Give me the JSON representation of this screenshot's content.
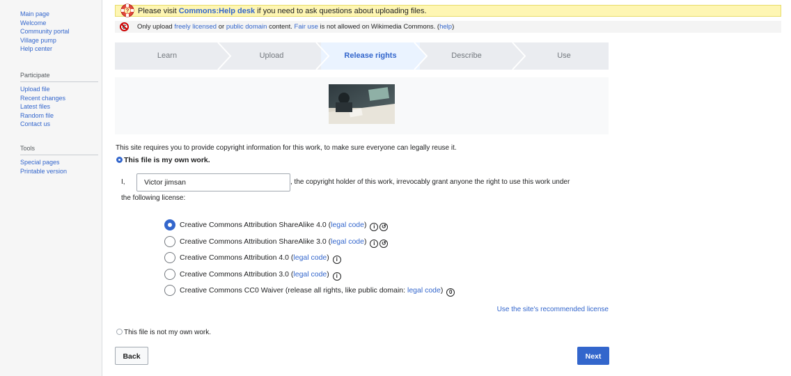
{
  "sidebar": {
    "navigation": [
      "Main page",
      "Welcome",
      "Community portal",
      "Village pump",
      "Help center"
    ],
    "participate_heading": "Participate",
    "participate": [
      "Upload file",
      "Recent changes",
      "Latest files",
      "Random file",
      "Contact us"
    ],
    "tools_heading": "Tools",
    "tools": [
      "Special pages",
      "Printable version"
    ]
  },
  "notice_help": {
    "prefix": "Please visit ",
    "link": "Commons:Help desk",
    "suffix": " if you need to ask questions about uploading files."
  },
  "notice_license": {
    "t1": "Only upload ",
    "l1": "freely licensed",
    "t2": " or ",
    "l2": "public domain",
    "t3": " content. ",
    "l3": "Fair use",
    "t4": " is not allowed on Wikimedia Commons. (",
    "l4": "help",
    "t5": ")"
  },
  "steps": [
    "Learn",
    "Upload",
    "Release rights",
    "Describe",
    "Use"
  ],
  "active_step": "Release rights",
  "intro": "This site requires you to provide copyright information for this work, to make sure everyone can legally reuse it.",
  "own_work_label": "This file is my own work.",
  "grant": {
    "prefix": "I,",
    "name_value": "Victor jimsan",
    "suffix": ", the copyright holder of this work, irrevocably grant anyone the right to use this work under",
    "line2": "the following license:"
  },
  "licenses": [
    {
      "text": "Creative Commons Attribution ShareAlike 4.0 (",
      "link": "legal code",
      "after": ")",
      "selected": true,
      "icons": [
        "attribution-icon",
        "sharealike-icon"
      ]
    },
    {
      "text": "Creative Commons Attribution ShareAlike 3.0 (",
      "link": "legal code",
      "after": ")",
      "selected": false,
      "icons": [
        "attribution-icon",
        "sharealike-icon"
      ]
    },
    {
      "text": "Creative Commons Attribution 4.0 (",
      "link": "legal code",
      "after": ")",
      "selected": false,
      "icons": [
        "attribution-icon"
      ]
    },
    {
      "text": "Creative Commons Attribution 3.0 (",
      "link": "legal code",
      "after": ")",
      "selected": false,
      "icons": [
        "attribution-icon"
      ]
    },
    {
      "text": "Creative Commons CC0 Waiver (release all rights, like public domain: ",
      "link": "legal code",
      "after": ")",
      "selected": false,
      "icons": [
        "zero-icon"
      ]
    }
  ],
  "recommend_link": "Use the site's recommended license",
  "not_own_work_label": "This file is not my own work.",
  "buttons": {
    "back": "Back",
    "next": "Next"
  },
  "colors": {
    "link": "#3366cc",
    "notice_bg": "#fef6b3",
    "primary_button": "#3366cc",
    "steps_bg": "#eaecf0"
  }
}
